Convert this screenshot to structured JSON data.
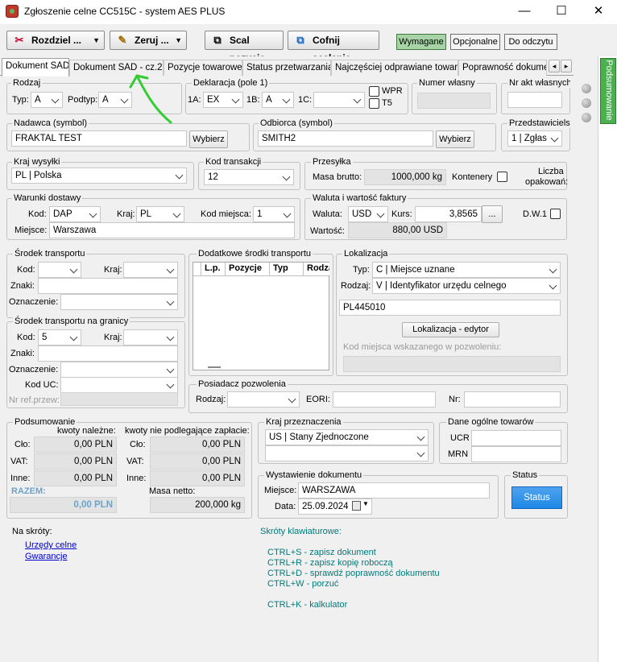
{
  "window": {
    "title": "Zgłoszenie celne CC515C - system AES PLUS",
    "min": "—",
    "max": "☐",
    "close": "✕"
  },
  "toolbar": {
    "split": "Rozdziel ...",
    "reset": "Zeruj ...",
    "merge": "Scal pozycje",
    "unmerge": "Cofnij scalanie",
    "view_required": "Wymagane",
    "view_optional": "Opcjonalne",
    "view_readonly": "Do odczytu"
  },
  "tabs": [
    "Dokument SAD",
    "Dokument SAD - cz.2",
    "Pozycje towarowe",
    "Status przetwarzania",
    "Najczęściej odprawiane towary",
    "Poprawność dokumen"
  ],
  "tab_scroll": {
    "left": "◂",
    "right": "▸"
  },
  "side_tab": "Podsumowanie",
  "rodzaj": {
    "label": "Rodzaj",
    "typ_label": "Typ:",
    "typ": "A",
    "podtyp_label": "Podtyp:",
    "podtyp": "A"
  },
  "deklaracja": {
    "label": "Deklaracja (pole 1)",
    "a1_label": "1A:",
    "a1": "EX",
    "b1_label": "1B:",
    "b1": "A",
    "c1_label": "1C:",
    "c1": "",
    "wpr": "WPR",
    "t5": "T5"
  },
  "numer_wlasny": {
    "label": "Numer własny",
    "value": ""
  },
  "nr_akt": {
    "label": "Nr akt własnych",
    "value": ""
  },
  "nadawca": {
    "label": "Nadawca (symbol)",
    "value": "FRAKTAL TEST",
    "button": "Wybierz"
  },
  "odbiorca": {
    "label": "Odbiorca (symbol)",
    "value": "SMITH2",
    "button": "Wybierz"
  },
  "przedstawiciel": {
    "label": "Przedstawicielstwo",
    "value": "1 | Zgłas"
  },
  "kraj_wysylki": {
    "label": "Kraj wysyłki",
    "value": "PL | Polska"
  },
  "kod_transakcji": {
    "label": "Kod transakcji",
    "value": "12"
  },
  "przesylka": {
    "label": "Przesyłka",
    "masa_label": "Masa brutto:",
    "masa": "1000,000 kg",
    "kontenery": "Kontenery",
    "liczba": "Liczba",
    "opakowan": "opakowań:"
  },
  "warunki": {
    "label": "Warunki dostawy",
    "kod_label": "Kod:",
    "kod": "DAP",
    "kraj_label": "Kraj:",
    "kraj": "PL",
    "kod_miejsca_label": "Kod miejsca:",
    "kod_miejsca": "1",
    "miejsce_label": "Miejsce:",
    "miejsce": "Warszawa"
  },
  "waluta": {
    "label": "Waluta i wartość faktury",
    "waluta_label": "Waluta:",
    "waluta": "USD",
    "kurs_label": "Kurs:",
    "kurs": "3,8565",
    "more": "...",
    "dw1": "D.W.1",
    "wartosc_label": "Wartość:",
    "wartosc": "880,00 USD"
  },
  "srodek_transportu": {
    "label": "Środek transportu",
    "kod_label": "Kod:",
    "kraj_label": "Kraj:",
    "znaki_label": "Znaki:",
    "oznaczenie_label": "Oznaczenie:"
  },
  "dodatkowe": {
    "label": "Dodatkowe środki transportu",
    "cols": [
      "L.p.",
      "Pozycje",
      "Typ",
      "Rodza"
    ]
  },
  "lokalizacja": {
    "label": "Lokalizacja",
    "typ_label": "Typ:",
    "typ": "C | Miejsce uznane",
    "rodzaj_label": "Rodzaj:",
    "rodzaj": "V | Identyfikator urzędu celnego",
    "value": "PL445010",
    "button": "Lokalizacja - edytor",
    "kod_label": "Kod miejsca wskazanego w pozwoleniu:"
  },
  "granica": {
    "label": "Środek transportu na granicy",
    "kod_label": "Kod:",
    "kod": "5",
    "kraj_label": "Kraj:",
    "znaki_label": "Znaki:",
    "oznaczenie_label": "Oznaczenie:",
    "kod_uc_label": "Kod UC:",
    "nr_ref_label": "Nr ref.przew:"
  },
  "posiadacz": {
    "label": "Posiadacz pozwolenia",
    "rodzaj_label": "Rodzaj:",
    "eori_label": "EORI:",
    "nr_label": "Nr:"
  },
  "podsumowanie": {
    "label": "Podsumowanie",
    "kwoty_nalezne": "kwoty należne:",
    "kwoty_nie": "kwoty nie podlegające zapłacie:",
    "clo_label": "Cło:",
    "vat_label": "VAT:",
    "inne_label": "Inne:",
    "clo": "0,00 PLN",
    "vat": "0,00 PLN",
    "inne": "0,00 PLN",
    "clo2": "0,00 PLN",
    "vat2": "0,00 PLN",
    "inne2": "0,00 PLN",
    "razem_label": "RAZEM:",
    "razem": "0,00 PLN",
    "masa_netto_label": "Masa netto:",
    "masa_netto": "200,000 kg"
  },
  "kraj_przeznaczenia": {
    "label": "Kraj przeznaczenia",
    "value": "US | Stany Zjednoczone",
    "value2": ""
  },
  "dane_ogolne": {
    "label": "Dane ogólne towarów",
    "ucr_label": "UCR",
    "mrn_label": "MRN"
  },
  "wystawienie": {
    "label": "Wystawienie dokumentu",
    "miejsce_label": "Miejsce:",
    "miejsce": "WARSZAWA",
    "data_label": "Data:",
    "data": "25.09.2024"
  },
  "status": {
    "label": "Status",
    "button": "Status"
  },
  "skroty": {
    "label": "Na skróty:",
    "links": [
      "Urzędy celne",
      "Gwarancje"
    ]
  },
  "klawiatura": {
    "label": "Skróty klawiaturowe:",
    "items": [
      "CTRL+S - zapisz dokument",
      "CTRL+R - zapisz kopię roboczą",
      "CTRL+D - sprawdź poprawność dokumentu",
      "CTRL+W - porzuć",
      "CTRL+K - kalkulator"
    ]
  },
  "colors": {
    "active_view": "#a7d3a7",
    "side_tab": "#4caf50",
    "status_btn": "#1e88e5",
    "annotation": "#33cc33",
    "link": "#0000cc",
    "teal": "#007a7a"
  }
}
